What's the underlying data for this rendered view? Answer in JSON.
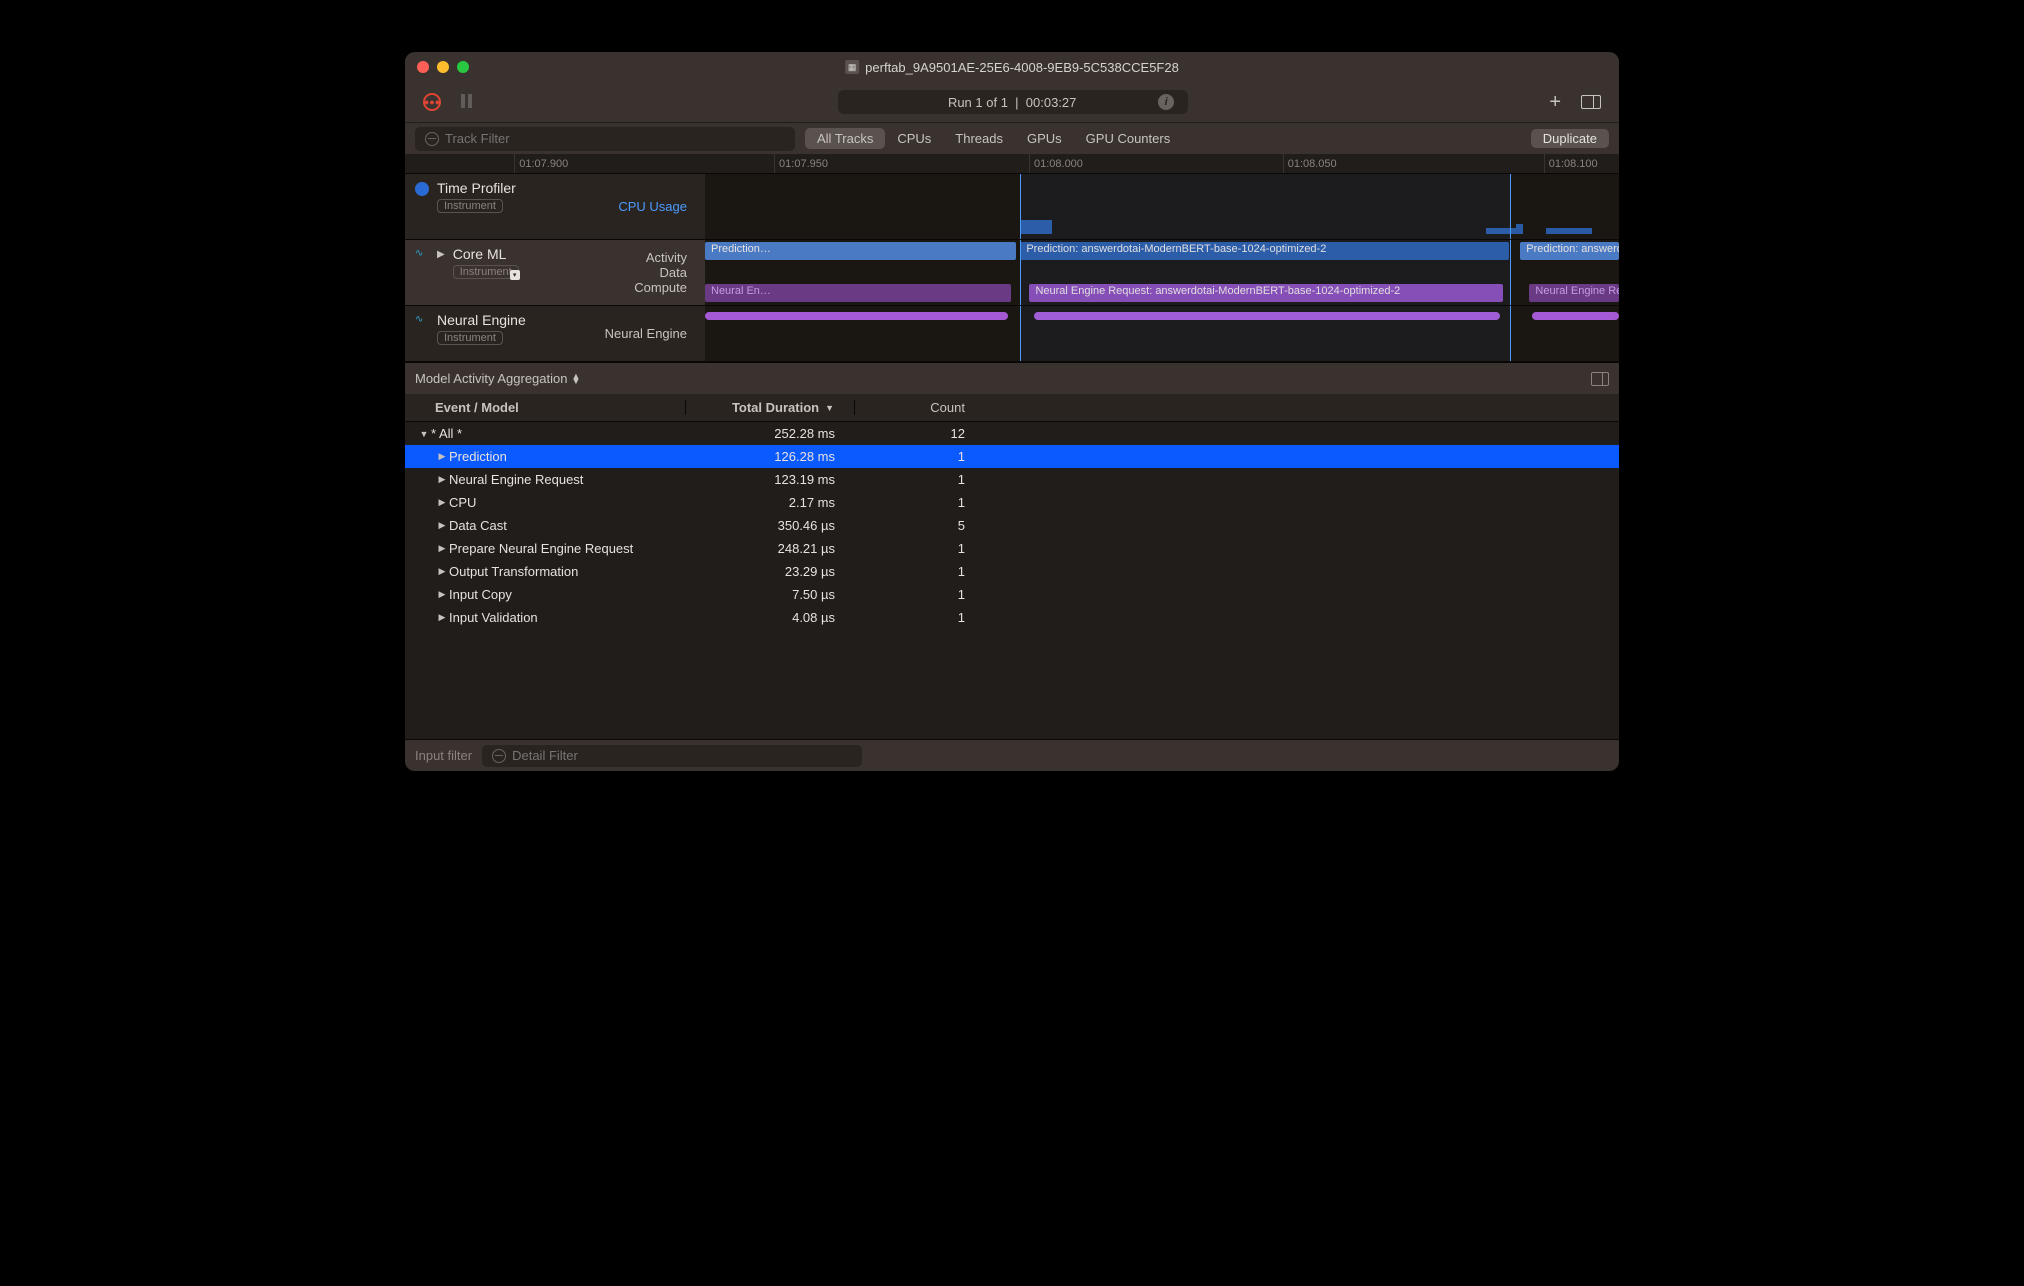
{
  "window": {
    "title": "perftab_9A9501AE-25E6-4008-9EB9-5C538CCE5F28"
  },
  "toolbar": {
    "run_label": "Run 1 of 1",
    "time_label": "00:03:27"
  },
  "filterbar": {
    "track_placeholder": "Track Filter",
    "tabs": [
      "All Tracks",
      "CPUs",
      "Threads",
      "GPUs",
      "GPU Counters"
    ],
    "active_tab": 0,
    "duplicate_label": "Duplicate"
  },
  "ruler": {
    "ticks": [
      {
        "label": "01:07.900",
        "pos": 9
      },
      {
        "label": "01:07.950",
        "pos": 30.4
      },
      {
        "label": "01:08.000",
        "pos": 51.4
      },
      {
        "label": "01:08.050",
        "pos": 72.3
      },
      {
        "label": "01:08.100",
        "pos": 93.8
      }
    ]
  },
  "tracks": {
    "time_profiler": {
      "name": "Time Profiler",
      "badge": "Instrument",
      "sub": "CPU Usage"
    },
    "core_ml": {
      "name": "Core ML",
      "badge": "Instrument",
      "subs": [
        "Activity",
        "Data",
        "Compute"
      ]
    },
    "neural_engine": {
      "name": "Neural Engine",
      "badge": "Instrument",
      "sub": "Neural Engine"
    }
  },
  "bars": {
    "pred_left": "Prediction…",
    "pred_main": "Prediction: answerdotai-ModernBERT-base-1024-optimized-2",
    "pred_right": "Prediction: answerdotai-ModernBE…",
    "ne_left": "Neural En…",
    "ne_main": "Neural Engine Request: answerdotai-ModernBERT-base-1024-optimized-2",
    "ne_right": "Neural Engine Request: answerdo…"
  },
  "detail": {
    "title": "Model Activity Aggregation",
    "columns": {
      "event": "Event / Model",
      "duration": "Total Duration",
      "count": "Count"
    }
  },
  "rows": [
    {
      "indent": 0,
      "disc": "down",
      "label": "* All *",
      "duration": "252.28 ms",
      "count": "12",
      "selected": false
    },
    {
      "indent": 1,
      "disc": "right",
      "label": "Prediction",
      "duration": "126.28 ms",
      "count": "1",
      "selected": true
    },
    {
      "indent": 1,
      "disc": "right",
      "label": "Neural Engine Request",
      "duration": "123.19 ms",
      "count": "1",
      "selected": false
    },
    {
      "indent": 1,
      "disc": "right",
      "label": "CPU",
      "duration": "2.17 ms",
      "count": "1",
      "selected": false
    },
    {
      "indent": 1,
      "disc": "right",
      "label": "Data Cast",
      "duration": "350.46 µs",
      "count": "5",
      "selected": false
    },
    {
      "indent": 1,
      "disc": "right",
      "label": "Prepare Neural Engine Request",
      "duration": "248.21 µs",
      "count": "1",
      "selected": false
    },
    {
      "indent": 1,
      "disc": "right",
      "label": "Output Transformation",
      "duration": "23.29 µs",
      "count": "1",
      "selected": false
    },
    {
      "indent": 1,
      "disc": "right",
      "label": "Input Copy",
      "duration": "7.50 µs",
      "count": "1",
      "selected": false
    },
    {
      "indent": 1,
      "disc": "right",
      "label": "Input Validation",
      "duration": "4.08 µs",
      "count": "1",
      "selected": false
    }
  ],
  "bottom": {
    "input_label": "Input filter",
    "detail_placeholder": "Detail Filter"
  }
}
